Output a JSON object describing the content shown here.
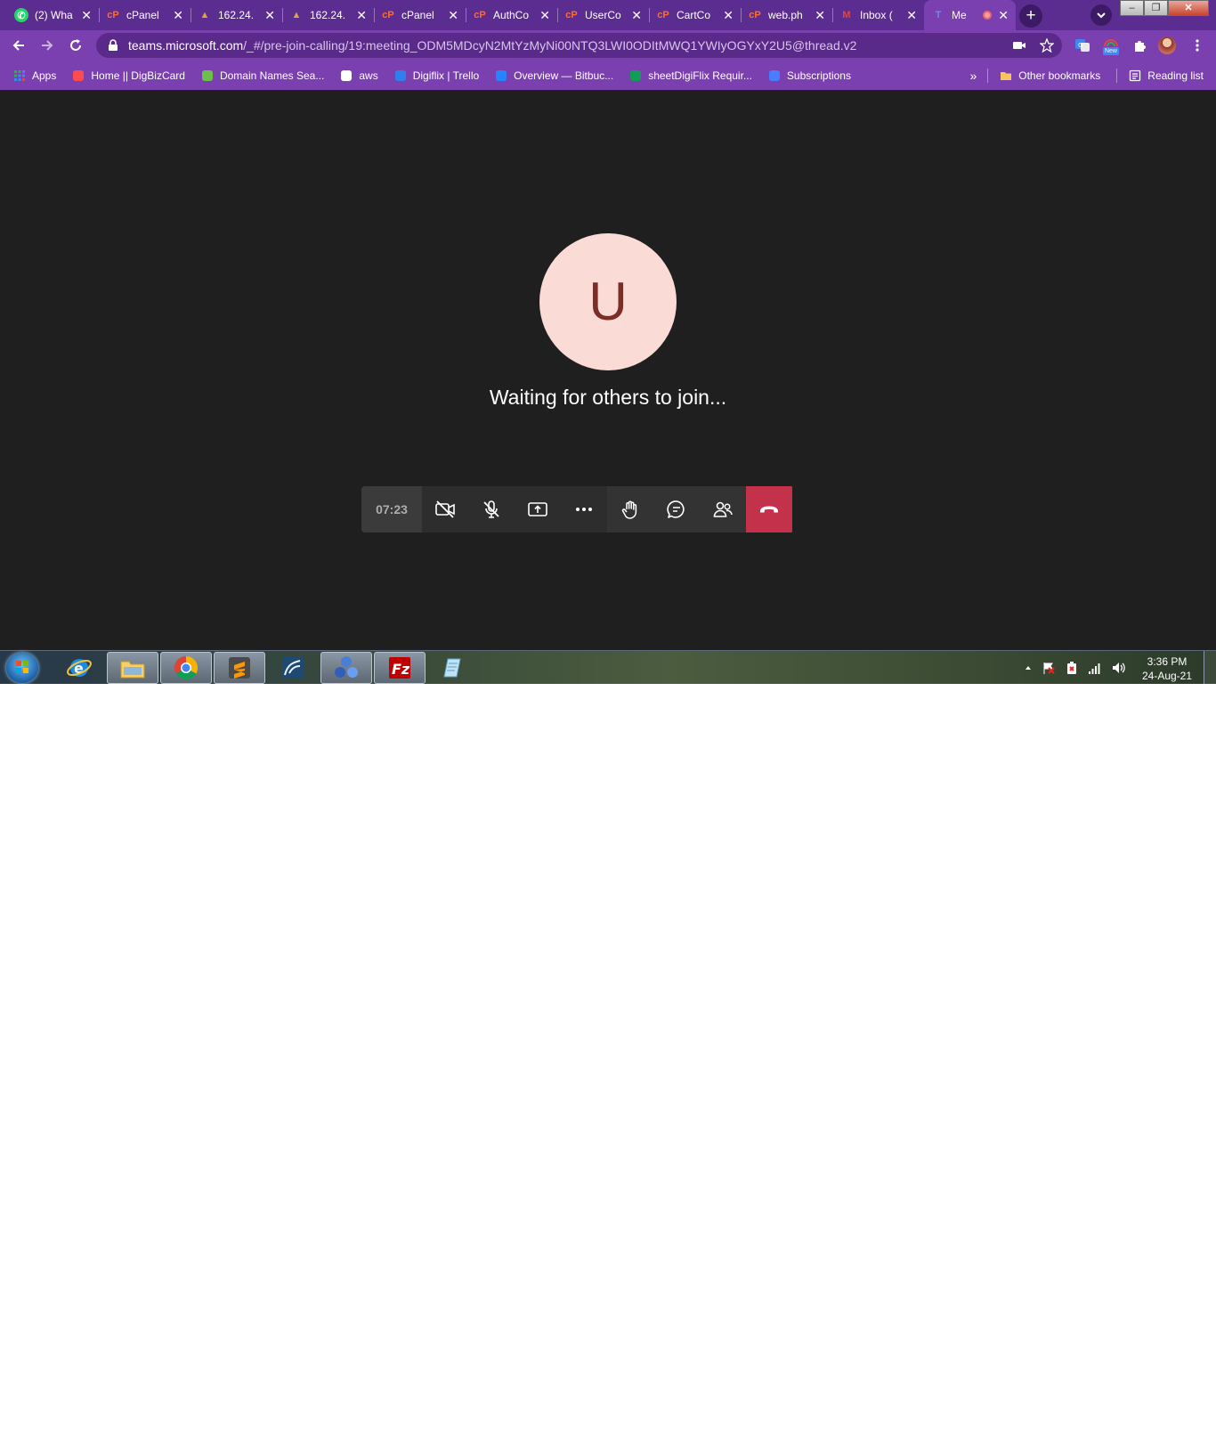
{
  "browser": {
    "tabs": [
      {
        "title": "(2) Wha",
        "icon": "whatsapp-icon",
        "color": "#25d366"
      },
      {
        "title": "cPanel",
        "icon": "cpanel-icon",
        "color": "#ff6c2c"
      },
      {
        "title": "162.24.",
        "icon": "tomcat-icon",
        "color": "#d9a441"
      },
      {
        "title": "162.24.",
        "icon": "tomcat-icon",
        "color": "#d9a441"
      },
      {
        "title": "cPanel",
        "icon": "cpanel-icon",
        "color": "#ff6c2c"
      },
      {
        "title": "AuthCo",
        "icon": "cpanel-icon",
        "color": "#ff6c2c"
      },
      {
        "title": "UserCo",
        "icon": "cpanel-icon",
        "color": "#ff6c2c"
      },
      {
        "title": "CartCo",
        "icon": "cpanel-icon",
        "color": "#ff6c2c"
      },
      {
        "title": "web.ph",
        "icon": "cpanel-icon",
        "color": "#ff6c2c"
      },
      {
        "title": "Inbox (",
        "icon": "gmail-icon",
        "color": "#ea4335"
      },
      {
        "title": "Me",
        "icon": "teams-icon",
        "color": "#7b83eb",
        "active": true,
        "recording": true
      }
    ],
    "url_host": "teams.microsoft.com",
    "url_path": "/_#/pre-join-calling/19:meeting_ODM5MDcyN2MtYzMyNi00NTQ3LWI0ODItMWQ1YWIyOGYxY2U5@thread.v2",
    "new_badge": "New",
    "accent_color": "#7b40b0"
  },
  "bookmarks": {
    "items": [
      {
        "label": "Apps",
        "icon": "apps-grid-icon"
      },
      {
        "label": "Home || DigBizCard",
        "icon": "digbizcard-icon"
      },
      {
        "label": "Domain Names Sea...",
        "icon": "domain-search-icon"
      },
      {
        "label": "aws",
        "icon": "aws-icon"
      },
      {
        "label": "Digiflix | Trello",
        "icon": "trello-icon"
      },
      {
        "label": "Overview — Bitbuc...",
        "icon": "bitbucket-icon"
      },
      {
        "label": "sheetDigiFlix Requir...",
        "icon": "google-sheets-icon"
      },
      {
        "label": "Subscriptions",
        "icon": "subscriptions-icon"
      }
    ],
    "overflow": "»",
    "other_bookmarks": "Other bookmarks",
    "reading_list": "Reading list"
  },
  "meeting": {
    "avatar_initial": "U",
    "avatar_bg": "#fadbd6",
    "avatar_fg": "#7a2e27",
    "status": "Waiting for others to join...",
    "timer": "07:23",
    "hangup_color": "#c4314b",
    "controls": [
      "camera-off-icon",
      "mic-off-icon",
      "share-screen-icon",
      "more-options-icon",
      "raise-hand-icon",
      "chat-icon",
      "participants-icon",
      "hang-up-icon"
    ]
  },
  "taskbar": {
    "apps": [
      "internet-explorer-icon",
      "file-explorer-icon",
      "chrome-icon",
      "sublime-text-icon",
      "mysql-workbench-icon",
      "app-icon",
      "filezilla-icon",
      "notepad-icon"
    ],
    "time": "3:36 PM",
    "date": "24-Aug-21"
  }
}
